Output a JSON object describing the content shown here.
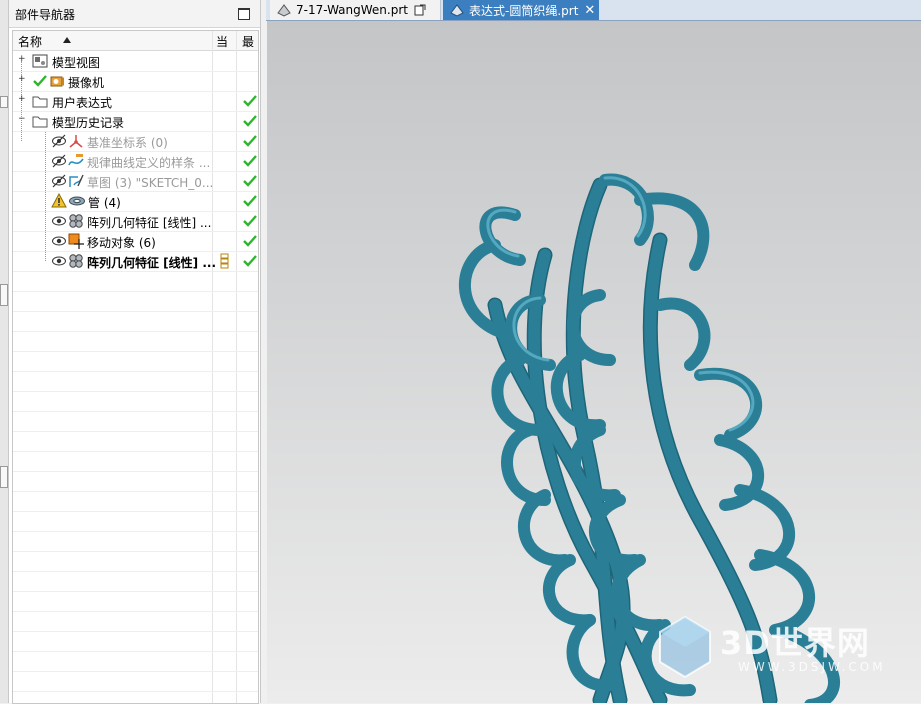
{
  "navigator": {
    "title": "部件导航器",
    "columns": {
      "name": "名称",
      "current": "当",
      "latest": "最"
    },
    "rows": [
      {
        "label": "模型视图"
      },
      {
        "label": "摄像机"
      },
      {
        "label": "用户表达式"
      },
      {
        "label": "模型历史记录"
      },
      {
        "label": "基准坐标系 (0)"
      },
      {
        "label": "规律曲线定义的样条 ..."
      },
      {
        "label": "草图 (3) \"SKETCH_0..."
      },
      {
        "label": "管 (4)"
      },
      {
        "label": "阵列几何特征 [线性] ..."
      },
      {
        "label": "移动对象 (6)"
      },
      {
        "label": "阵列几何特征 [线性] ..."
      }
    ]
  },
  "tabs": [
    {
      "label": "7-17-WangWen.prt"
    },
    {
      "label": "表达式-圆筒织绳.prt"
    }
  ],
  "watermark": {
    "main": "3D世界网",
    "sub": "WWW.3DSJW.COM"
  },
  "colors": {
    "rope": "#2a7f97",
    "check": "#2db62d",
    "active_tab": "#3c7fc1"
  },
  "icons": [
    "expand-plus-icon",
    "collapse-minus-icon",
    "model-view-icon",
    "camera-icon",
    "folder-icon",
    "eye-icon",
    "hidden-eye-icon",
    "datum-csys-icon",
    "law-spline-icon",
    "sketch-icon",
    "tube-icon",
    "pattern-feature-icon",
    "move-object-icon",
    "checkmark-icon",
    "part-file-icon",
    "close-icon"
  ]
}
